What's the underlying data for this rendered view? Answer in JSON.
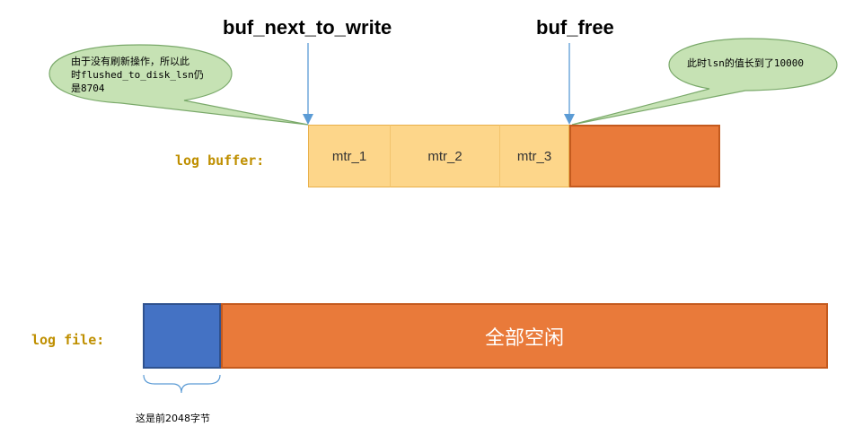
{
  "pointers": {
    "next_to_write": "buf_next_to_write",
    "free": "buf_free"
  },
  "callouts": {
    "left": "由于没有刷新操作，所以此\n时flushed_to_disk_lsn仍\n是8704",
    "right": "此时lsn的值长到了10000"
  },
  "log_buffer": {
    "label": "log buffer:",
    "segments": [
      "mtr_1",
      "mtr_2",
      "mtr_3"
    ]
  },
  "log_file": {
    "label": "log file:",
    "free_text": "全部空闲",
    "brace_note": "这是前2048字节"
  },
  "colors": {
    "segment_fill": "#fdd68a",
    "buffer_border": "#e8b04a",
    "free_fill": "#e97a3a",
    "blue_fill": "#4472c4",
    "arrow": "#5b9bd5",
    "bubble_fill": "#c6e2b4",
    "bubble_stroke": "#7aa96a",
    "label_color": "#bf8f00"
  },
  "icons": [
    "down-arrow-icon",
    "curly-brace-icon"
  ]
}
